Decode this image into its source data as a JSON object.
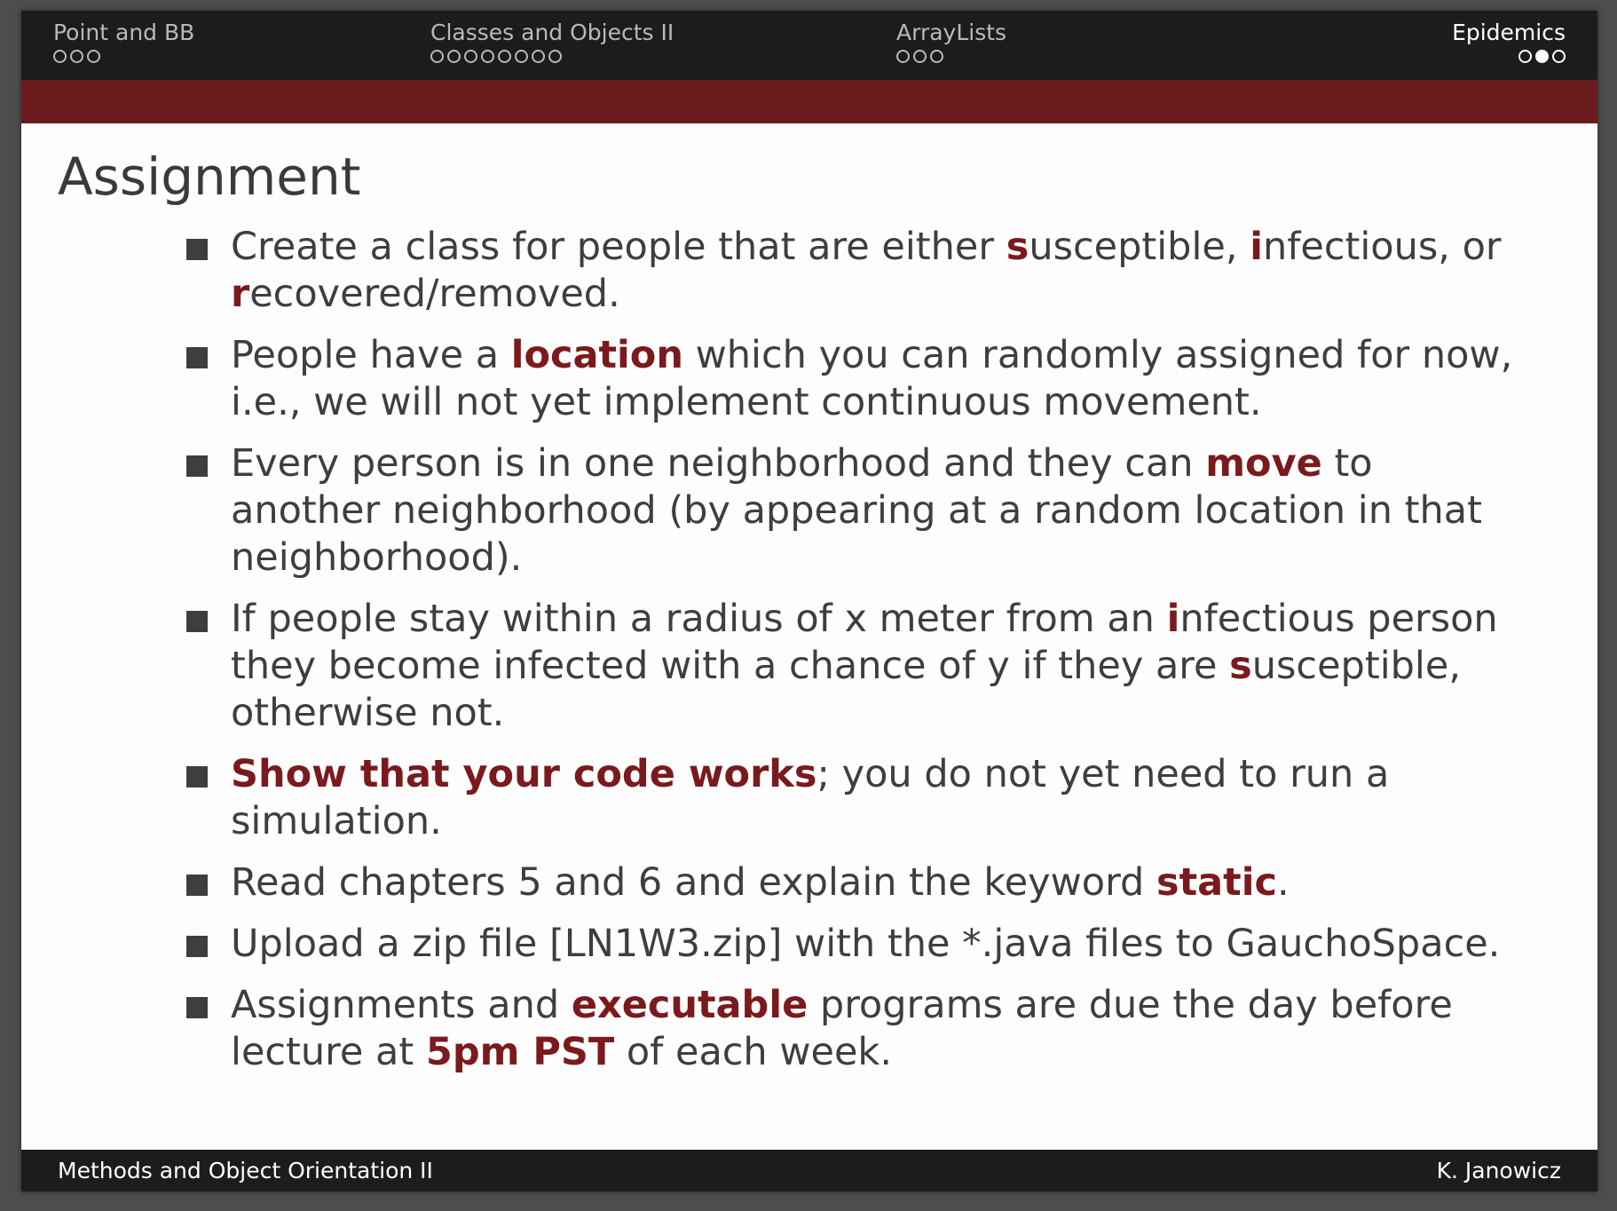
{
  "nav": {
    "sections": [
      {
        "label": "Point and BB",
        "dots": [
          false,
          false,
          false
        ],
        "active": false
      },
      {
        "label": "Classes and Objects II",
        "dots": [
          false,
          false,
          false,
          false,
          false,
          false,
          false,
          false
        ],
        "active": false
      },
      {
        "label": "ArrayLists",
        "dots": [
          false,
          false,
          false
        ],
        "active": false
      },
      {
        "label": "Epidemics",
        "dots": [
          false,
          true,
          false
        ],
        "active": true
      }
    ]
  },
  "colors": {
    "accent": "#7a1a1d",
    "bar": "#6b1a1d",
    "dark": "#1c1c1c"
  },
  "slide": {
    "title": "Assignment",
    "items": [
      [
        {
          "t": "Create a class for people that are either "
        },
        {
          "t": "s",
          "hl": true
        },
        {
          "t": "usceptible, "
        },
        {
          "t": "i",
          "hl": true
        },
        {
          "t": "nfectious, or "
        },
        {
          "t": "r",
          "hl": true
        },
        {
          "t": "ecovered/removed."
        }
      ],
      [
        {
          "t": "People have a "
        },
        {
          "t": "location",
          "hl": true
        },
        {
          "t": " which you can randomly assigned for now, i.e., we will not yet implement continuous movement."
        }
      ],
      [
        {
          "t": "Every person is in one neighborhood and they can "
        },
        {
          "t": "move",
          "hl": true
        },
        {
          "t": " to another neighborhood (by appearing at a random location in that neighborhood)."
        }
      ],
      [
        {
          "t": "If people stay within a radius of x meter from an "
        },
        {
          "t": "i",
          "hl": true
        },
        {
          "t": "nfectious person they become infected with a chance of y if they are "
        },
        {
          "t": "s",
          "hl": true
        },
        {
          "t": "usceptible, otherwise not."
        }
      ],
      [
        {
          "t": "Show that your code works",
          "hl": true
        },
        {
          "t": "; you do not yet need to run a simulation."
        }
      ],
      [
        {
          "t": "Read chapters 5 and 6 and explain the keyword "
        },
        {
          "t": "static",
          "hl": true
        },
        {
          "t": "."
        }
      ],
      [
        {
          "t": "Upload a zip file [LN1W3.zip] with the *.java files to GauchoSpace."
        }
      ],
      [
        {
          "t": "Assignments and "
        },
        {
          "t": "executable",
          "hl": true
        },
        {
          "t": " programs are due the day before lecture at "
        },
        {
          "t": "5pm PST",
          "hl": true
        },
        {
          "t": " of each week."
        }
      ]
    ]
  },
  "footer": {
    "left": "Methods and Object Orientation II",
    "right": "K. Janowicz"
  }
}
